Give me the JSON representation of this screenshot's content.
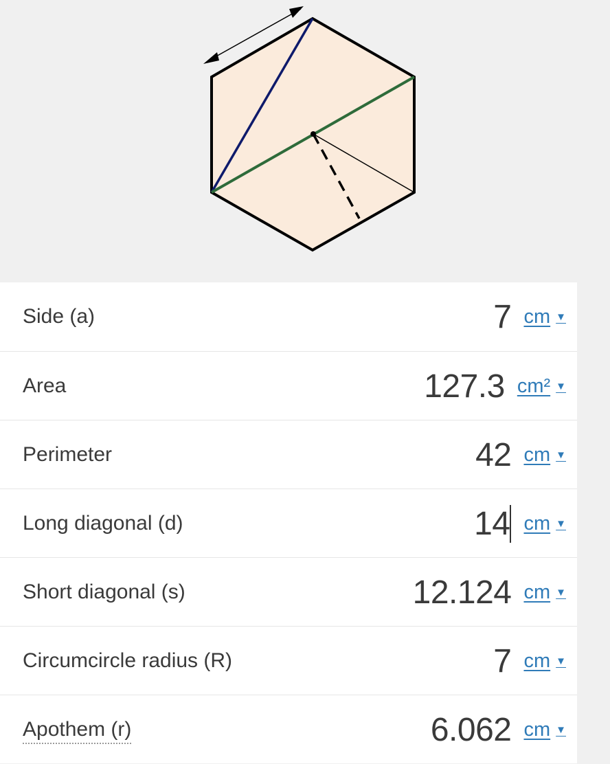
{
  "diagram": {
    "fill_color": "#fbebdc",
    "long_diagonal_color": "#2e6b3a",
    "short_diagonal_color": "#0e1a6b",
    "outline_color": "#000000"
  },
  "rows": [
    {
      "label": "Side (a)",
      "value": "7",
      "unit": "cm"
    },
    {
      "label": "Area",
      "value": "127.3",
      "unit": "cm²"
    },
    {
      "label": "Perimeter",
      "value": "42",
      "unit": "cm"
    },
    {
      "label": "Long diagonal (d)",
      "value": "14",
      "unit": "cm"
    },
    {
      "label": "Short diagonal (s)",
      "value": "12.124",
      "unit": "cm"
    },
    {
      "label": "Circumcircle radius (R)",
      "value": "7",
      "unit": "cm"
    },
    {
      "label": "Apothem (r)",
      "value": "6.062",
      "unit": "cm"
    }
  ],
  "dropdown_icon": "caret-down-icon",
  "accent_color": "#2f7bb8"
}
